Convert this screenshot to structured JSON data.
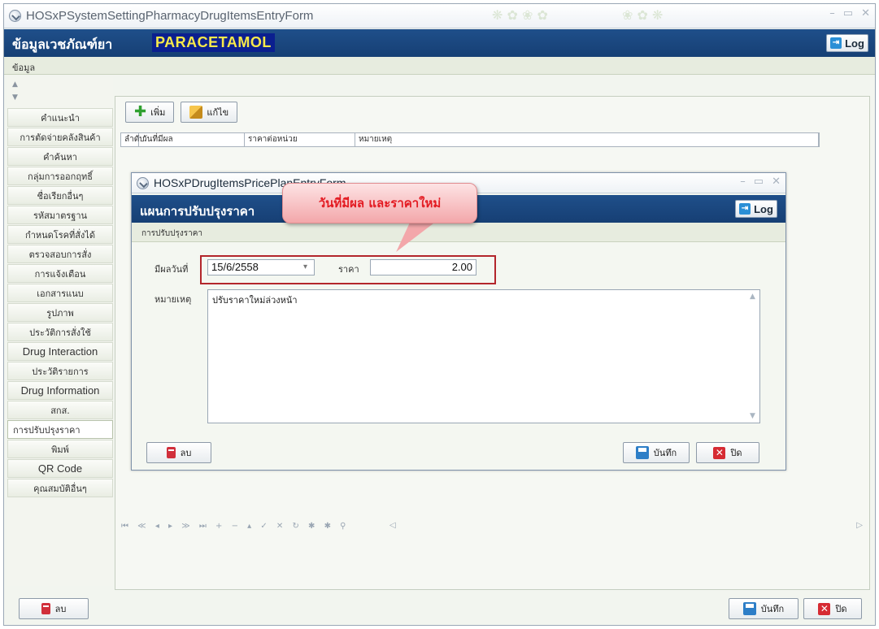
{
  "window": {
    "title": "HOSxPSystemSettingPharmacyDrugItemsEntryForm"
  },
  "header": {
    "title": "ข้อมูลเวชภัณฑ์ยา",
    "drug_name": "PARACETAMOL",
    "log_label": "Log"
  },
  "menu": {
    "label": "ข้อมูล"
  },
  "sidebar": {
    "items": [
      {
        "label": "คำแนะนำ",
        "big": false
      },
      {
        "label": "การตัดจ่ายคลังสินค้า",
        "big": false
      },
      {
        "label": "คำค้นหา",
        "big": false
      },
      {
        "label": "กลุ่มการออกฤทธิ์",
        "big": false
      },
      {
        "label": "ชื่อเรียกอื่นๆ",
        "big": false
      },
      {
        "label": "รหัสมาตรฐาน",
        "big": false
      },
      {
        "label": "กำหนดโรคที่สั่งได้",
        "big": false
      },
      {
        "label": "ตรวจสอบการสั่ง",
        "big": false
      },
      {
        "label": "การแจ้งเตือน",
        "big": false
      },
      {
        "label": "เอกสารแนบ",
        "big": false
      },
      {
        "label": "รูปภาพ",
        "big": false
      },
      {
        "label": "ประวัติการสั่งใช้",
        "big": false
      },
      {
        "label": "Drug Interaction",
        "big": true
      },
      {
        "label": "ประวัติรายการ",
        "big": false
      },
      {
        "label": "Drug Information",
        "big": true
      },
      {
        "label": "สกส.",
        "big": false
      },
      {
        "label": "การปรับปรุงราคา",
        "big": false,
        "active": true
      },
      {
        "label": "พิมพ์",
        "big": false
      },
      {
        "label": "QR Code",
        "big": true
      },
      {
        "label": "คุณสมบัติอื่นๆ",
        "big": false
      }
    ]
  },
  "toolbar": {
    "add_label": "เพิ่ม",
    "edit_label": "แก้ไข"
  },
  "grid": {
    "columns": [
      "ลำดับ",
      "วันที่มีผล",
      "ราคาต่อหน่วย",
      "หมายเหตุ"
    ]
  },
  "footer": {
    "delete_label": "ลบ",
    "save_label": "บันทึก",
    "close_label": "ปิด"
  },
  "dialog": {
    "title": "HOSxPDrugItemsPricePlanEntryForm",
    "header_title": "แผนการปรับปรุงราคา",
    "log_label": "Log",
    "section_label": "การปรับปรุงราคา",
    "effective_date_label": "มีผลวันที่",
    "effective_date_value": "15/6/2558",
    "price_label": "ราคา",
    "price_value": "2.00",
    "notes_label": "หมายเหตุ",
    "notes_value": "ปรับราคาใหม่ล่วงหน้า",
    "delete_label": "ลบ",
    "save_label": "บันทึก",
    "close_label": "ปิด"
  },
  "callout": {
    "text": "วันที่มีผล และราคาใหม่"
  }
}
